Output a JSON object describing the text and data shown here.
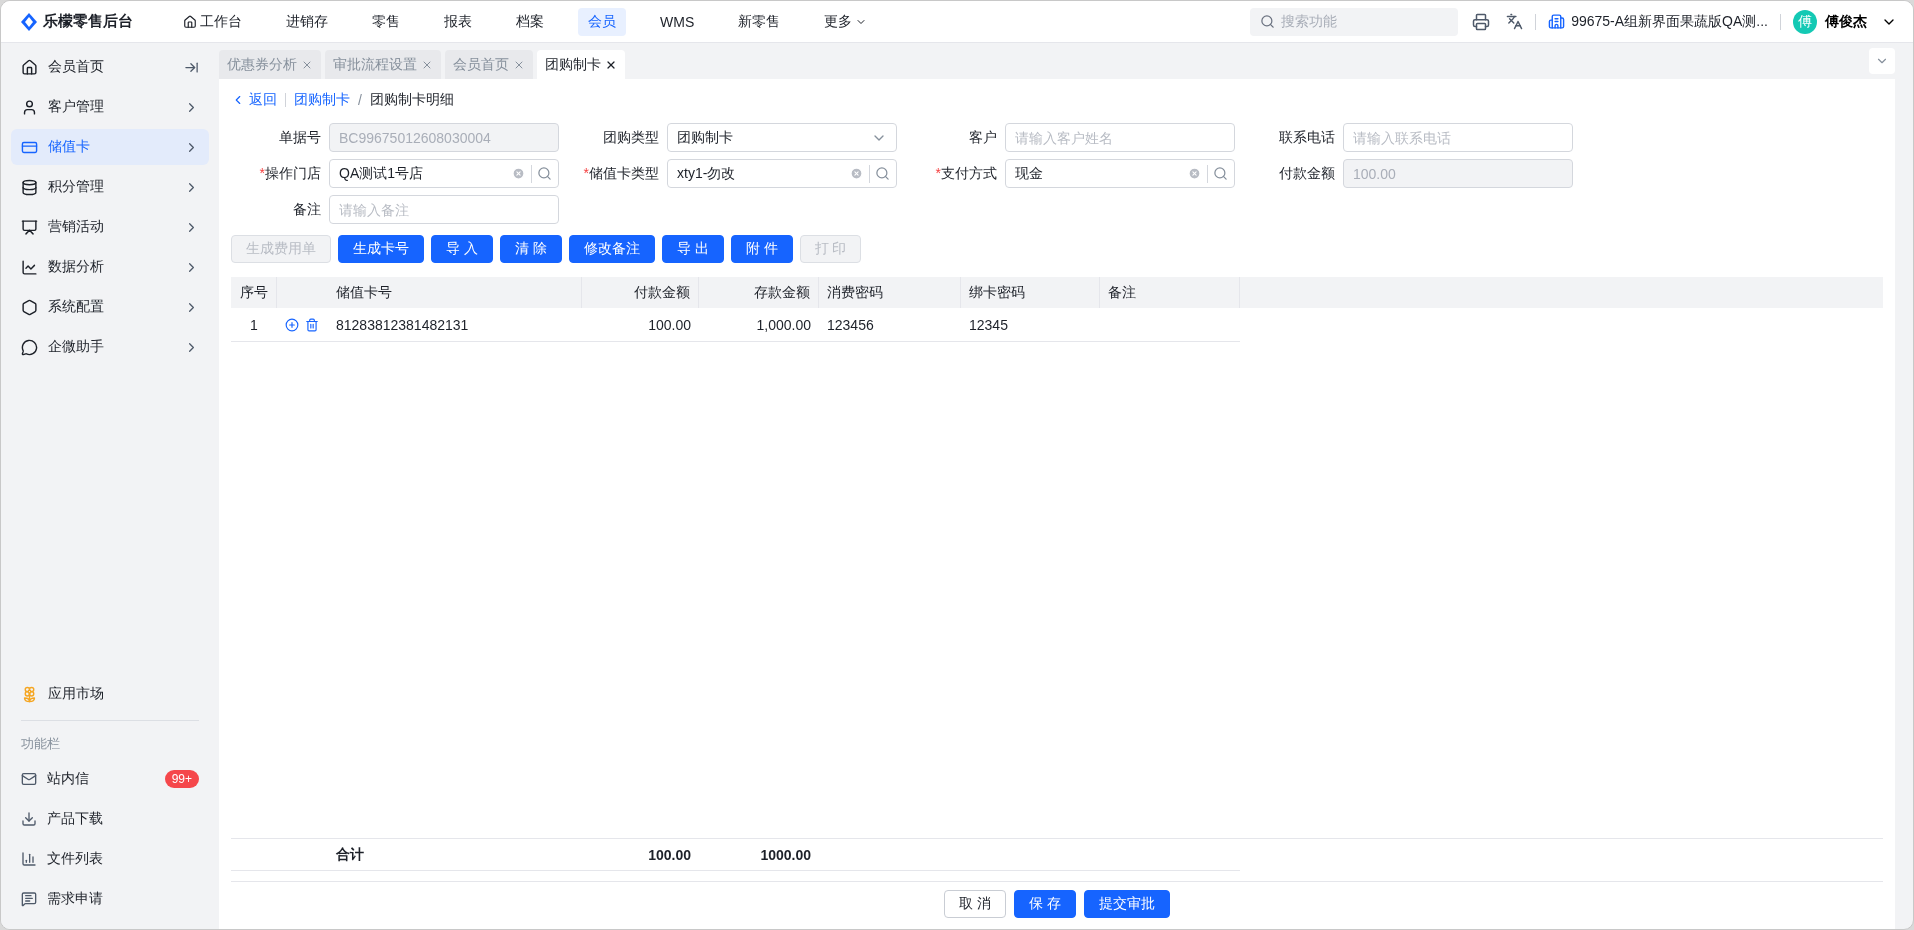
{
  "app": {
    "title": "乐檬零售后台"
  },
  "nav": [
    {
      "label": "工作台",
      "selected": false
    },
    {
      "label": "进销存",
      "selected": false
    },
    {
      "label": "零售",
      "selected": false
    },
    {
      "label": "报表",
      "selected": false
    },
    {
      "label": "档案",
      "selected": false
    },
    {
      "label": "会员",
      "selected": true
    },
    {
      "label": "WMS",
      "selected": false
    },
    {
      "label": "新零售",
      "selected": false
    },
    {
      "label": "更多",
      "selected": false
    }
  ],
  "search": {
    "placeholder": "搜索功能"
  },
  "org": "99675-A组新界面果蔬版QA测...",
  "user": {
    "avatar": "傅",
    "name": "傅俊杰"
  },
  "sidebar": {
    "items": [
      {
        "label": "会员首页",
        "selected": false
      },
      {
        "label": "客户管理",
        "selected": false
      },
      {
        "label": "储值卡",
        "selected": true
      },
      {
        "label": "积分管理",
        "selected": false
      },
      {
        "label": "营销活动",
        "selected": false
      },
      {
        "label": "数据分析",
        "selected": false
      },
      {
        "label": "系统配置",
        "selected": false
      },
      {
        "label": "企微助手",
        "selected": false
      }
    ],
    "market": "应用市场",
    "section": "功能栏",
    "tools": [
      {
        "label": "站内信",
        "badge": "99+"
      },
      {
        "label": "产品下载"
      },
      {
        "label": "文件列表"
      },
      {
        "label": "需求申请"
      }
    ]
  },
  "tabs": [
    {
      "label": "优惠券分析",
      "selected": false
    },
    {
      "label": "审批流程设置",
      "selected": false
    },
    {
      "label": "会员首页",
      "selected": false
    },
    {
      "label": "团购制卡",
      "selected": true
    }
  ],
  "breadcrumb": {
    "back": "返回",
    "parent": "团购制卡",
    "separator": "/",
    "current": "团购制卡明细"
  },
  "required_mark": "*",
  "form": [
    {
      "label": "单据号",
      "kind": "input",
      "required": false,
      "disabled": true,
      "value": "BC99675012608030004"
    },
    {
      "label": "团购类型",
      "kind": "select",
      "required": false,
      "disabled": false,
      "value": "团购制卡"
    },
    {
      "label": "客户",
      "kind": "input",
      "required": false,
      "disabled": false,
      "placeholder": "请输入客户姓名"
    },
    {
      "label": "联系电话",
      "kind": "input",
      "required": false,
      "disabled": false,
      "placeholder": "请输入联系电话"
    },
    {
      "label": "操作门店",
      "kind": "lookup",
      "required": true,
      "disabled": false,
      "value": "QA测试1号店"
    },
    {
      "label": "储值卡类型",
      "kind": "lookup",
      "required": true,
      "disabled": false,
      "value": "xty1-勿改"
    },
    {
      "label": "支付方式",
      "kind": "lookup",
      "required": true,
      "disabled": false,
      "value": "现金"
    },
    {
      "label": "付款金额",
      "kind": "input",
      "required": false,
      "disabled": true,
      "value": "100.00"
    },
    {
      "label": "备注",
      "kind": "input",
      "required": false,
      "disabled": false,
      "placeholder": "请输入备注"
    }
  ],
  "actions": [
    {
      "label": "生成费用单",
      "disabled": true
    },
    {
      "label": "生成卡号",
      "disabled": false
    },
    {
      "label": "导 入",
      "disabled": false
    },
    {
      "label": "清 除",
      "disabled": false
    },
    {
      "label": "修改备注",
      "disabled": false
    },
    {
      "label": "导 出",
      "disabled": false
    },
    {
      "label": "附 件",
      "disabled": false
    },
    {
      "label": "打 印",
      "disabled": true
    }
  ],
  "table": {
    "columns": [
      "序号",
      "储值卡号",
      "付款金额",
      "存款金额",
      "消费密码",
      "绑卡密码",
      "备注"
    ],
    "rows": [
      {
        "index": "1",
        "card": "81283812381482131",
        "pay": "100.00",
        "deposit": "1,000.00",
        "consume_pwd": "123456",
        "bind_pwd": "12345"
      }
    ],
    "total": {
      "label": "合计",
      "pay": "100.00",
      "deposit": "1000.00"
    }
  },
  "footer": [
    {
      "label": "取 消",
      "kind": "default"
    },
    {
      "label": "保 存",
      "kind": "primary"
    },
    {
      "label": "提交审批",
      "kind": "primary"
    }
  ]
}
